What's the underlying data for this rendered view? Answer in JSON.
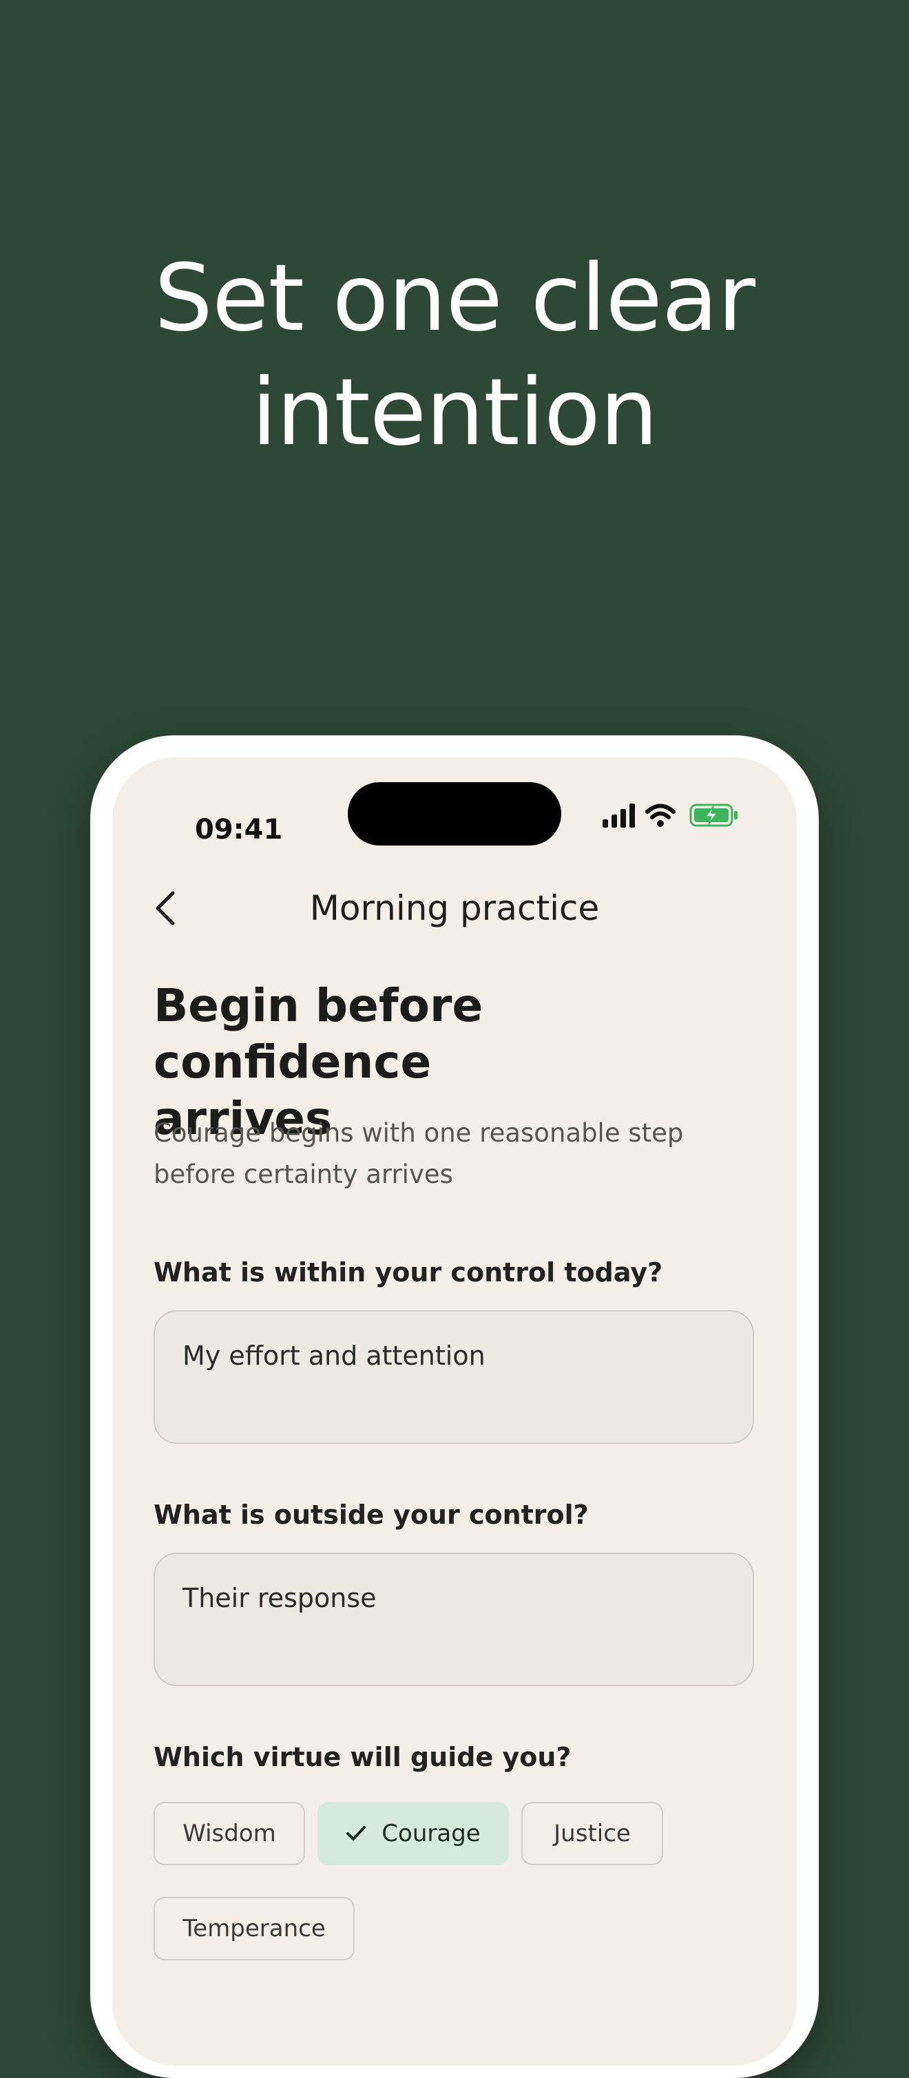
{
  "headline": {
    "line1": "Set one clear",
    "line2": "intention"
  },
  "status_bar": {
    "time": "09:41",
    "icons": [
      "signal-icon",
      "wifi-icon",
      "battery-charging-icon"
    ]
  },
  "nav": {
    "back_icon": "chevron-left-icon",
    "title": "Morning practice"
  },
  "page": {
    "title_line1": "Begin before confidence",
    "title_line2": "arrives",
    "subtitle_line1": "Courage begins with one reasonable step",
    "subtitle_line2": "before certainty arrives"
  },
  "questions": {
    "control": {
      "label": "What is within your control today?",
      "value": "My effort and attention"
    },
    "outside": {
      "label": "What is outside your control?",
      "value": "Their response"
    },
    "virtue": {
      "label": "Which virtue will guide you?"
    }
  },
  "virtues": [
    {
      "label": "Wisdom",
      "selected": false
    },
    {
      "label": "Courage",
      "selected": true
    },
    {
      "label": "Justice",
      "selected": false
    },
    {
      "label": "Temperance",
      "selected": false
    }
  ],
  "colors": {
    "background": "#2d4837",
    "screen": "#f3efe7",
    "field": "#ebe9e2",
    "selected_chip": "#d6eadb",
    "battery_green": "#3bb55b"
  }
}
